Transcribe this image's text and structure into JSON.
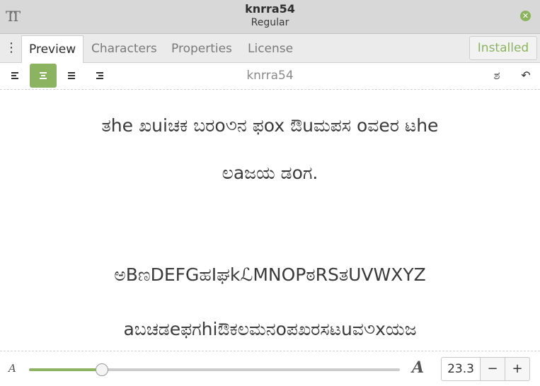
{
  "window": {
    "title": "knrra54",
    "subtitle": "Regular",
    "app_icon_glyph": "TT",
    "close_glyph": "✕"
  },
  "tabs": [
    {
      "label": "Preview",
      "active": true
    },
    {
      "label": "Characters",
      "active": false
    },
    {
      "label": "Properties",
      "active": false
    },
    {
      "label": "License",
      "active": false
    }
  ],
  "menu_glyph": "⋮",
  "installed_label": "Installed",
  "toolbar": {
    "font_name": "knrra54",
    "alignments": [
      "align-left",
      "align-center",
      "align-justify",
      "align-right"
    ],
    "active_alignment": "align-center",
    "right_icons": [
      "text-direction-icon",
      "undo-icon"
    ],
    "text_direction_glyph": "ಶ",
    "undo_glyph": "↶"
  },
  "preview": {
    "lines": [
      "ತhe ಖuiಚಕ ಬರo৩ನ ಫox ಔuಮಪಸ oವeರ ಟhe",
      "ಲaಜಯ ಡoಗ.",
      "ಅBಣDEFGಹIಘkℒMNOPಠRSತUVWXYZ",
      "aಬಚಡeಫಗhiಔಕಲಮನoಪಖರಸಟuವ৩xಯಜ"
    ]
  },
  "size_control": {
    "small_glyph": "A",
    "large_glyph": "A",
    "value": "23.3",
    "slider_fraction": 0.197,
    "minus_label": "−",
    "plus_label": "+"
  },
  "colors": {
    "accent": "#8cb35f",
    "titlebar_bg": "#d8d8d8",
    "tabbar_bg": "#ebebeb"
  }
}
